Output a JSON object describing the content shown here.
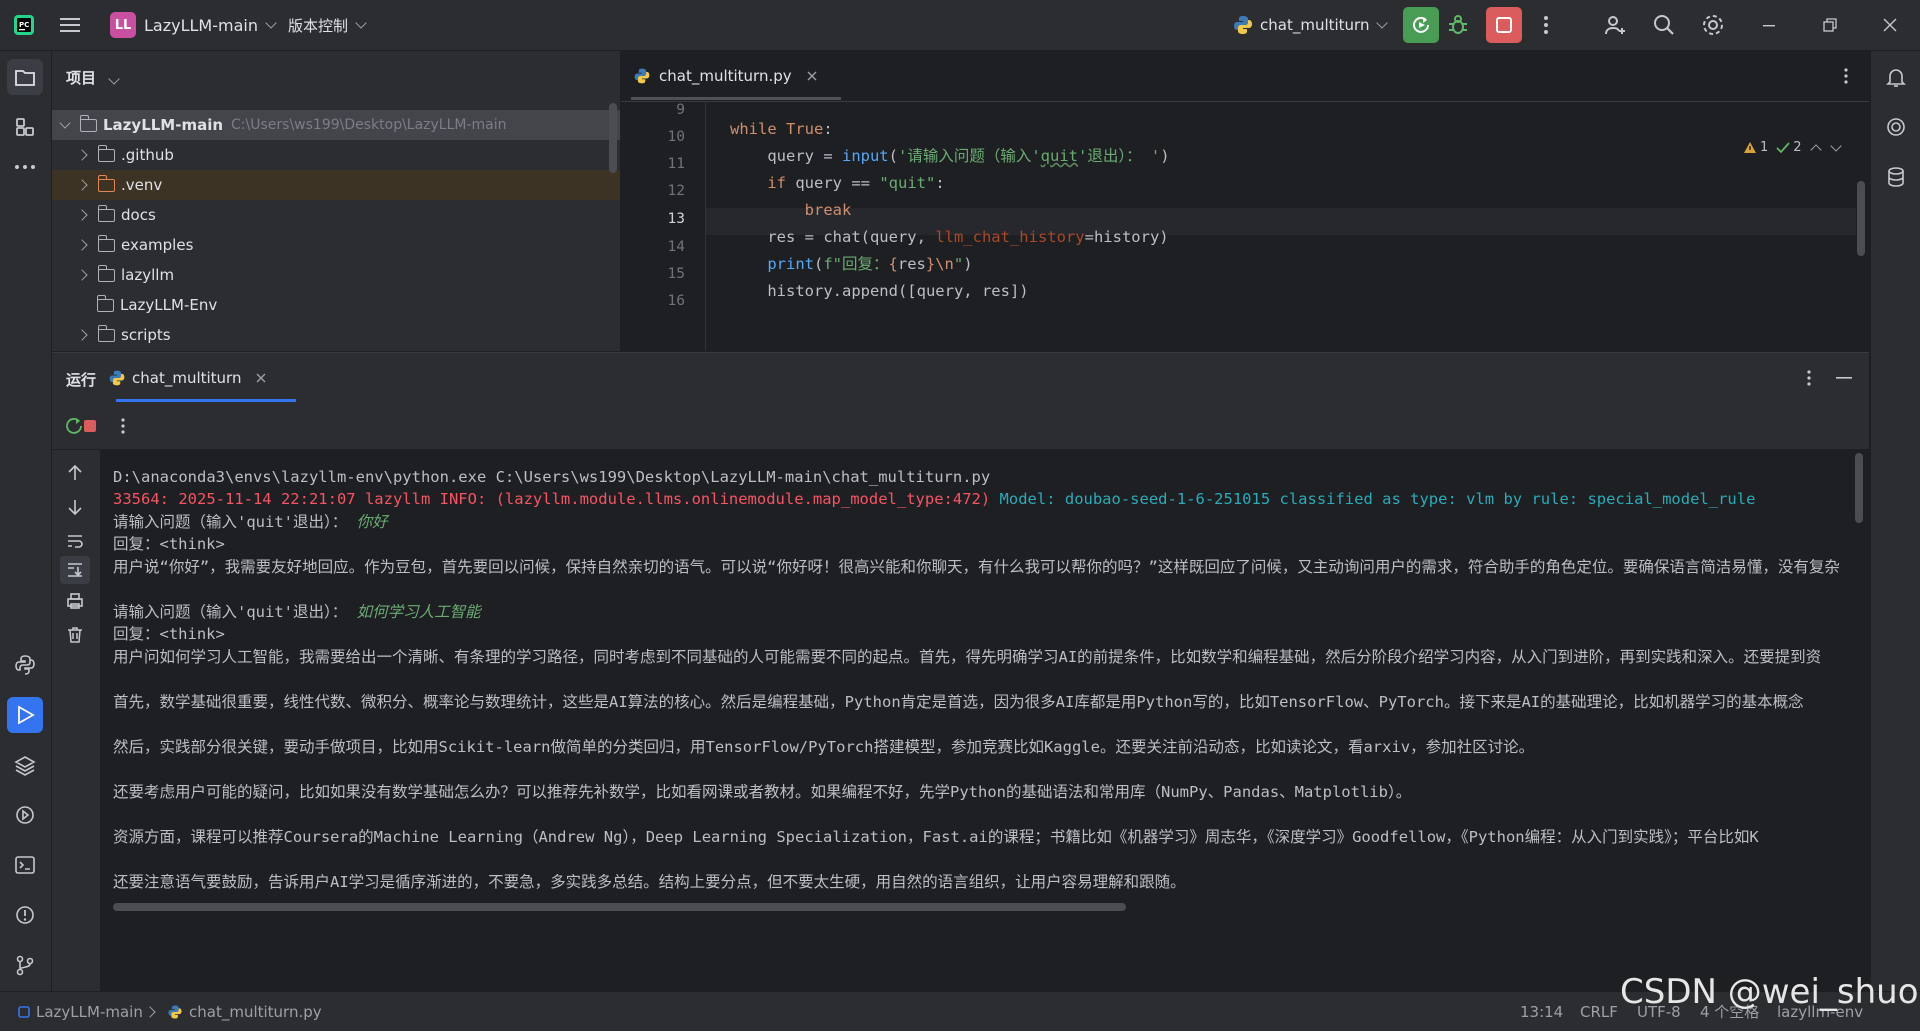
{
  "titlebar": {
    "project_badge": "LL",
    "project_name": "LazyLLM-main",
    "vcs_label": "版本控制",
    "run_config": "chat_multiturn",
    "brand_color": "#c94fa1",
    "run_button_color": "#499c54",
    "stop_button_color": "#db5c5c"
  },
  "project_panel": {
    "title": "项目",
    "root": {
      "name": "LazyLLM-main",
      "path": "C:\\Users\\ws199\\Desktop\\LazyLLM-main"
    },
    "items": [
      {
        "name": ".github",
        "expandable": true
      },
      {
        "name": ".venv",
        "expandable": true,
        "excluded": true
      },
      {
        "name": "docs",
        "expandable": true
      },
      {
        "name": "examples",
        "expandable": true
      },
      {
        "name": "lazyllm",
        "expandable": true
      },
      {
        "name": "LazyLLM-Env",
        "expandable": false
      },
      {
        "name": "scripts",
        "expandable": true
      }
    ]
  },
  "editor": {
    "tab": "chat_multiturn.py",
    "warnings": "1",
    "checks": "2",
    "line_numbers": [
      "9",
      "10",
      "11",
      "12",
      "13",
      "14",
      "15",
      "16"
    ],
    "current_line": "13"
  },
  "run_panel": {
    "label": "运行",
    "tab": "chat_multiturn",
    "console": {
      "command": "D:\\anaconda3\\envs\\lazyllm-env\\python.exe C:\\Users\\ws199\\Desktop\\LazyLLM-main\\chat_multiturn.py",
      "log_prefix": "33564: 2025-11-14 22:21:07 lazyllm INFO: (lazyllm.module.llms.onlinemodule.map_model_type:472)",
      "log_msg": " Model: doubao-seed-1-6-251015 classified as type: vlm by rule: special_model_rule",
      "prompt": "请输入问题（输入'quit'退出）：",
      "input1": "你好",
      "reply_label": "回复：<think>",
      "reply1": "用户说“你好”，我需要友好地回应。作为豆包，首先要回以问候，保持自然亲切的语气。可以说“你好呀！很高兴能和你聊天，有什么我可以帮你的吗？”这样既回应了问候，又主动询问用户的需求，符合助手的角色定位。要确保语言简洁易懂，没有复杂",
      "input2": "如何学习人工智能",
      "reply2_p1": "用户问如何学习人工智能，我需要给出一个清晰、有条理的学习路径，同时考虑到不同基础的人可能需要不同的起点。首先，得先明确学习AI的前提条件，比如数学和编程基础，然后分阶段介绍学习内容，从入门到进阶，再到实践和深入。还要提到资",
      "reply2_p2": "首先，数学基础很重要，线性代数、微积分、概率论与数理统计，这些是AI算法的核心。然后是编程基础，Python肯定是首选，因为很多AI库都是用Python写的，比如TensorFlow、PyTorch。接下来是AI的基础理论，比如机器学习的基本概念",
      "reply2_p3": "然后，实践部分很关键，要动手做项目，比如用Scikit-learn做简单的分类回归，用TensorFlow/PyTorch搭建模型，参加竞赛比如Kaggle。还要关注前沿动态，比如读论文，看arxiv，参加社区讨论。",
      "reply2_p4": "还要考虑用户可能的疑问，比如如果没有数学基础怎么办？可以推荐先补数学，比如看网课或者教材。如果编程不好，先学Python的基础语法和常用库（NumPy、Pandas、Matplotlib）。",
      "reply2_p5": "资源方面，课程可以推荐Coursera的Machine Learning（Andrew Ng），Deep Learning Specialization，Fast.ai的课程；书籍比如《机器学习》周志华，《深度学习》Goodfellow，《Python编程：从入门到实践》；平台比如K",
      "reply2_p6": "还要注意语气要鼓励，告诉用户AI学习是循序渐进的，不要急，多实践多总结。结构上要分点，但不要太生硬，用自然的语言组织，让用户容易理解和跟随。"
    }
  },
  "statusbar": {
    "project": "LazyLLM-main",
    "file": "chat_multiturn.py",
    "position": "13:14",
    "line_sep": "CRLF",
    "encoding": "UTF-8",
    "indent": "4 个空格",
    "interpreter": "lazyllm-env"
  },
  "watermark": "CSDN @wei_shuo"
}
